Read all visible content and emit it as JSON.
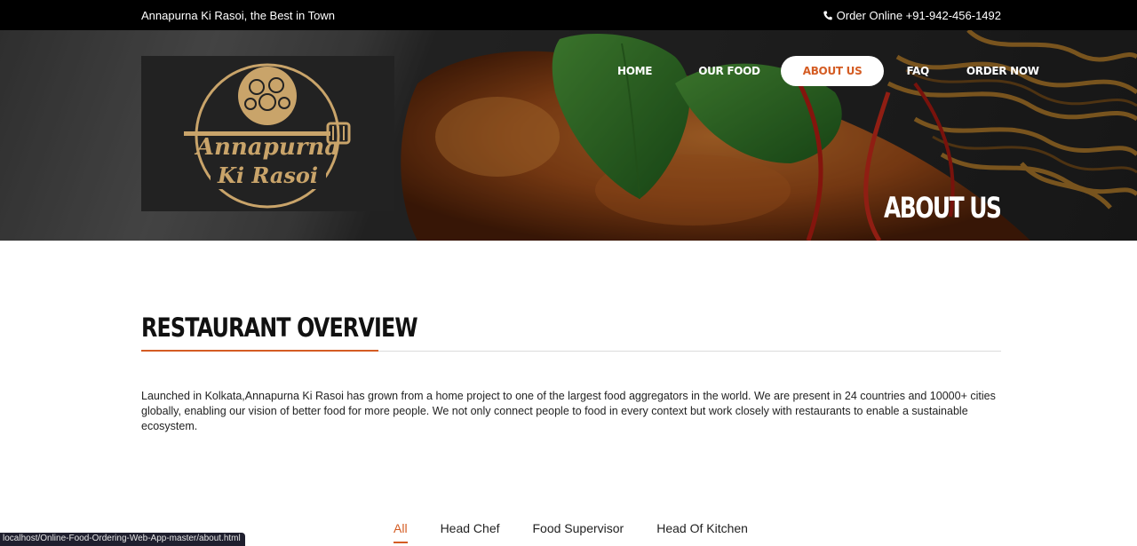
{
  "topbar": {
    "tagline": "Annapurna Ki Rasoi, the Best in Town",
    "order_text": "Order Online +91-942-456-1492",
    "phone_icon": "phone-icon"
  },
  "logo": {
    "line1": "Annapurna",
    "line2": "Ki Rasoi",
    "color": "#c9a46a"
  },
  "nav": {
    "items": [
      {
        "label": "HOME"
      },
      {
        "label": "OUR FOOD"
      },
      {
        "label": "ABOUT US",
        "active": true
      },
      {
        "label": "FAQ"
      },
      {
        "label": "ORDER NOW"
      }
    ]
  },
  "hero": {
    "title": "ABOUT US"
  },
  "overview": {
    "heading": "RESTAURANT OVERVIEW",
    "text": "Launched in Kolkata,Annapurna Ki Rasoi has grown from a home project to one of the largest food aggregators in the world. We are present in 24 countries and 10000+ cities globally, enabling our vision of better food for more people. We not only connect people to food in every context but work closely with restaurants to enable a sustainable ecosystem."
  },
  "team_tabs": {
    "items": [
      {
        "label": "All",
        "active": true
      },
      {
        "label": "Head Chef"
      },
      {
        "label": "Food Supervisor"
      },
      {
        "label": "Head Of Kitchen"
      }
    ]
  },
  "status_bar": {
    "url": "localhost/Online-Food-Ordering-Web-App-master/about.html"
  },
  "colors": {
    "accent": "#d45c23",
    "topbar_bg": "#000000",
    "logo_gold": "#c9a46a"
  }
}
